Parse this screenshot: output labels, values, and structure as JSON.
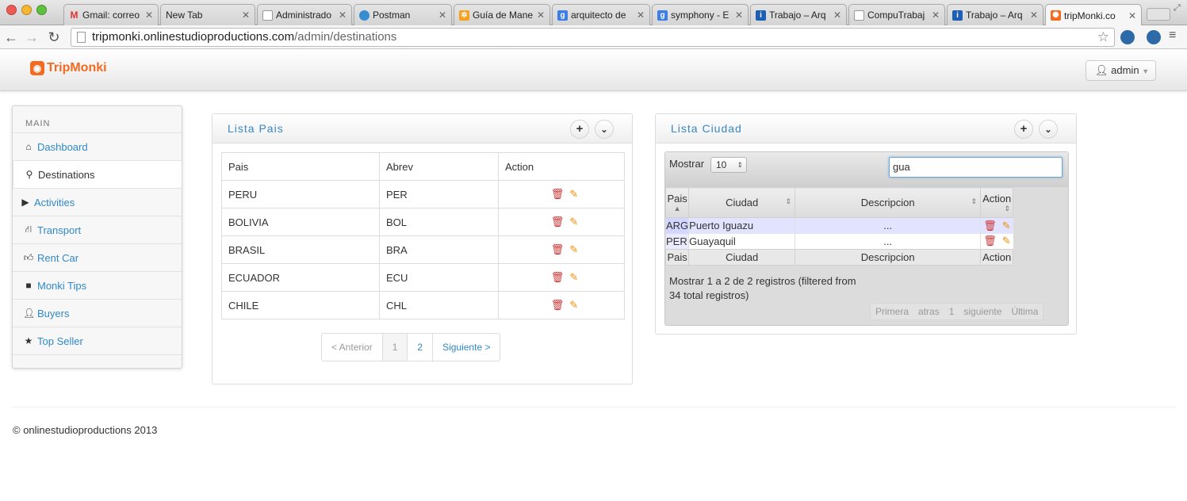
{
  "browser": {
    "tabs": [
      {
        "title": "Gmail: correo",
        "favicon": "gmail-icon"
      },
      {
        "title": "New Tab",
        "favicon": "none"
      },
      {
        "title": "Administrado",
        "favicon": "page-icon"
      },
      {
        "title": "Postman",
        "favicon": "globe-icon"
      },
      {
        "title": "Guía de Mane",
        "favicon": "joomla-icon"
      },
      {
        "title": "arquitecto de",
        "favicon": "google-icon"
      },
      {
        "title": "symphony - E",
        "favicon": "google-icon"
      },
      {
        "title": "Trabajo – Arq",
        "favicon": "info-icon"
      },
      {
        "title": "CompuTrabaj",
        "favicon": "page-icon"
      },
      {
        "title": "Trabajo – Arq",
        "favicon": "info-icon"
      },
      {
        "title": "tripMonki.co",
        "favicon": "tripmonki-icon"
      }
    ],
    "url_host": "tripmonki.onlinestudioproductions.com",
    "url_path": "/admin/destinations"
  },
  "app": {
    "logo_text": "TripMonki",
    "brand_color": "#f26b21",
    "user_label": "admin"
  },
  "sidebar": {
    "header": "MAIN",
    "items": [
      {
        "label": "Dashboard",
        "icon": "home-icon"
      },
      {
        "label": "Destinations",
        "icon": "map-marker-icon"
      },
      {
        "label": "Activities",
        "icon": "play-icon"
      },
      {
        "label": "Transport",
        "icon": "road-icon"
      },
      {
        "label": "Rent Car",
        "icon": "thumbs-up-icon"
      },
      {
        "label": "Monki Tips",
        "icon": "briefcase-icon"
      },
      {
        "label": "Buyers",
        "icon": "user-icon"
      },
      {
        "label": "Top Seller",
        "icon": "star-icon"
      }
    ]
  },
  "pais_panel": {
    "title": "Lista Pais",
    "columns": [
      "Pais",
      "Abrev",
      "Action"
    ],
    "rows": [
      {
        "pais": "PERU",
        "abrev": "PER"
      },
      {
        "pais": "BOLIVIA",
        "abrev": "BOL"
      },
      {
        "pais": "BRASIL",
        "abrev": "BRA"
      },
      {
        "pais": "ECUADOR",
        "abrev": "ECU"
      },
      {
        "pais": "CHILE",
        "abrev": "CHL"
      }
    ],
    "pager": {
      "prev": "< Anterior",
      "pages": [
        "1",
        "2"
      ],
      "next": "Siguiente >"
    }
  },
  "ciudad_panel": {
    "title": "Lista Ciudad",
    "show_label": "Mostrar",
    "show_value": "10",
    "search_value": "gua",
    "columns": [
      "Pais",
      "Ciudad",
      "Descripcion",
      "Action"
    ],
    "rows": [
      {
        "pais": "ARG",
        "ciudad": "Puerto Iguazu",
        "descripcion": "..."
      },
      {
        "pais": "PER",
        "ciudad": "Guayaquil",
        "descripcion": "..."
      }
    ],
    "info_line1": "Mostrar 1 a 2 de 2 registros (filtered from",
    "info_line2": "34 total registros)",
    "pager": [
      "Primera",
      "atras",
      "1",
      "siguiente",
      "Última"
    ]
  },
  "footer": {
    "text": "© onlinestudioproductions 2013"
  }
}
